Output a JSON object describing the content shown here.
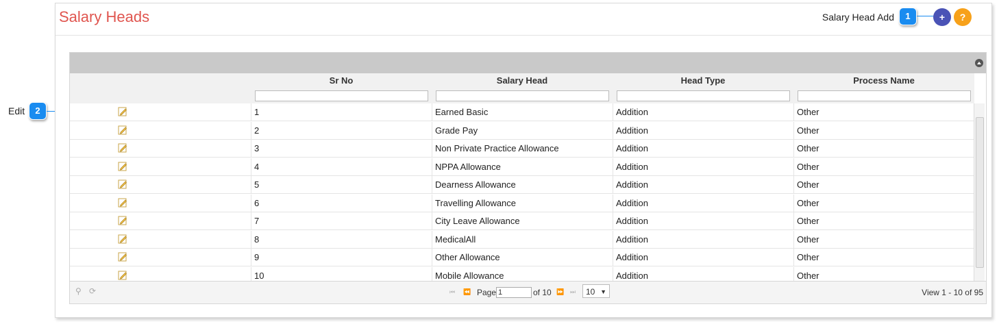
{
  "header": {
    "title": "Salary Heads",
    "add_label": "Salary Head Add",
    "add_button": "+",
    "help_button": "?",
    "badge_add": "1"
  },
  "callouts": {
    "edit_label": "Edit",
    "badge_edit": "2"
  },
  "table": {
    "columns": [
      "Sr No",
      "Salary Head",
      "Head Type",
      "Process Name"
    ],
    "rows": [
      {
        "sr": "1",
        "head": "Earned Basic",
        "type": "Addition",
        "process": "Other"
      },
      {
        "sr": "2",
        "head": "Grade Pay",
        "type": "Addition",
        "process": "Other"
      },
      {
        "sr": "3",
        "head": "Non Private Practice Allowance",
        "type": "Addition",
        "process": "Other"
      },
      {
        "sr": "4",
        "head": "NPPA Allowance",
        "type": "Addition",
        "process": "Other"
      },
      {
        "sr": "5",
        "head": "Dearness Allowance",
        "type": "Addition",
        "process": "Other"
      },
      {
        "sr": "6",
        "head": "Travelling Allowance",
        "type": "Addition",
        "process": "Other"
      },
      {
        "sr": "7",
        "head": "City Leave Allowance",
        "type": "Addition",
        "process": "Other"
      },
      {
        "sr": "8",
        "head": "MedicalAll",
        "type": "Addition",
        "process": "Other"
      },
      {
        "sr": "9",
        "head": "Other Allowance",
        "type": "Addition",
        "process": "Other"
      },
      {
        "sr": "10",
        "head": "Mobile Allowance",
        "type": "Addition",
        "process": "Other"
      }
    ]
  },
  "pager": {
    "page_label": "Page",
    "page_value": "1",
    "of_label": "of 10",
    "rows_per_page": "10",
    "view_text": "View 1 - 10 of 95"
  },
  "colors": {
    "title": "#e0554f",
    "badge": "#1a8cf0",
    "add_button": "#4a53b6",
    "help_button": "#f7a11a"
  }
}
